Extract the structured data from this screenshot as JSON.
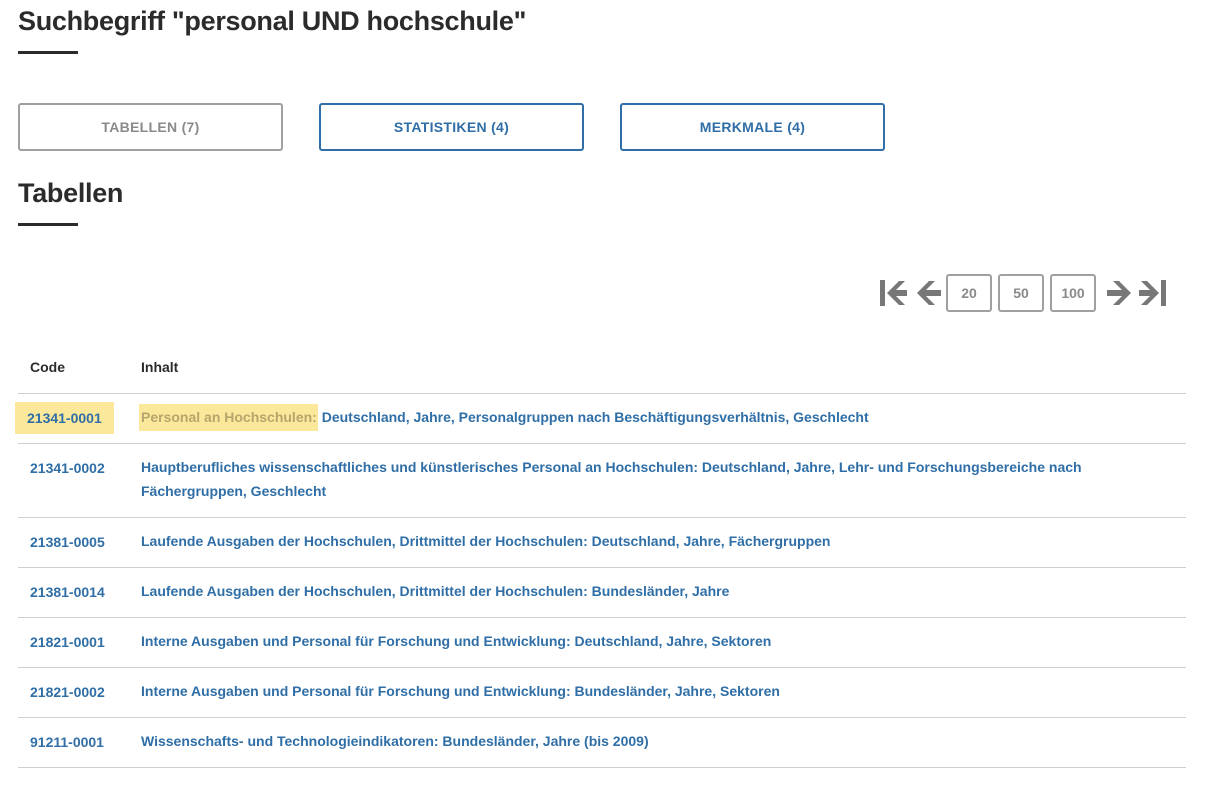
{
  "search_title": "Suchbegriff \"personal UND hochschule\"",
  "tabs": [
    {
      "label": "TABELLEN (7)",
      "active": true
    },
    {
      "label": "STATISTIKEN (4)",
      "active": false
    },
    {
      "label": "MERKMALE (4)",
      "active": false
    }
  ],
  "section_title": "Tabellen",
  "pager": {
    "icons": [
      "first-page-icon",
      "previous-page-icon",
      "next-page-icon",
      "last-page-icon"
    ],
    "page_sizes": [
      "20",
      "50",
      "100"
    ]
  },
  "table": {
    "headers": {
      "code": "Code",
      "inhalt": "Inhalt"
    },
    "rows": [
      {
        "code": "21341-0001",
        "highlight": "Personal an Hochschulen:",
        "rest": " Deutschland, Jahre, Personalgruppen nach Beschäftigungsverhältnis, Geschlecht"
      },
      {
        "code": "21341-0002",
        "inhalt": "Hauptberufliches wissenschaftliches und künstlerisches Personal an Hochschulen: Deutschland, Jahre, Lehr- und Forschungsbereiche nach Fächergruppen, Geschlecht"
      },
      {
        "code": "21381-0005",
        "inhalt": "Laufende Ausgaben der Hochschulen, Drittmittel der Hochschulen: Deutschland, Jahre, Fächergruppen"
      },
      {
        "code": "21381-0014",
        "inhalt": "Laufende Ausgaben der Hochschulen, Drittmittel der Hochschulen: Bundesländer, Jahre"
      },
      {
        "code": "21821-0001",
        "inhalt": "Interne Ausgaben und Personal für Forschung und Entwicklung: Deutschland, Jahre, Sektoren"
      },
      {
        "code": "21821-0002",
        "inhalt": "Interne Ausgaben und Personal für Forschung und Entwicklung: Bundesländer, Jahre, Sektoren"
      },
      {
        "code": "91211-0001",
        "inhalt": "Wissenschafts- und Technologieindikatoren: Bundesländer, Jahre (bis 2009)"
      }
    ]
  },
  "colors": {
    "link": "#2f6ea6",
    "highlight_bg": "#fbe89a",
    "inactive_gray": "#8a8a8a"
  }
}
